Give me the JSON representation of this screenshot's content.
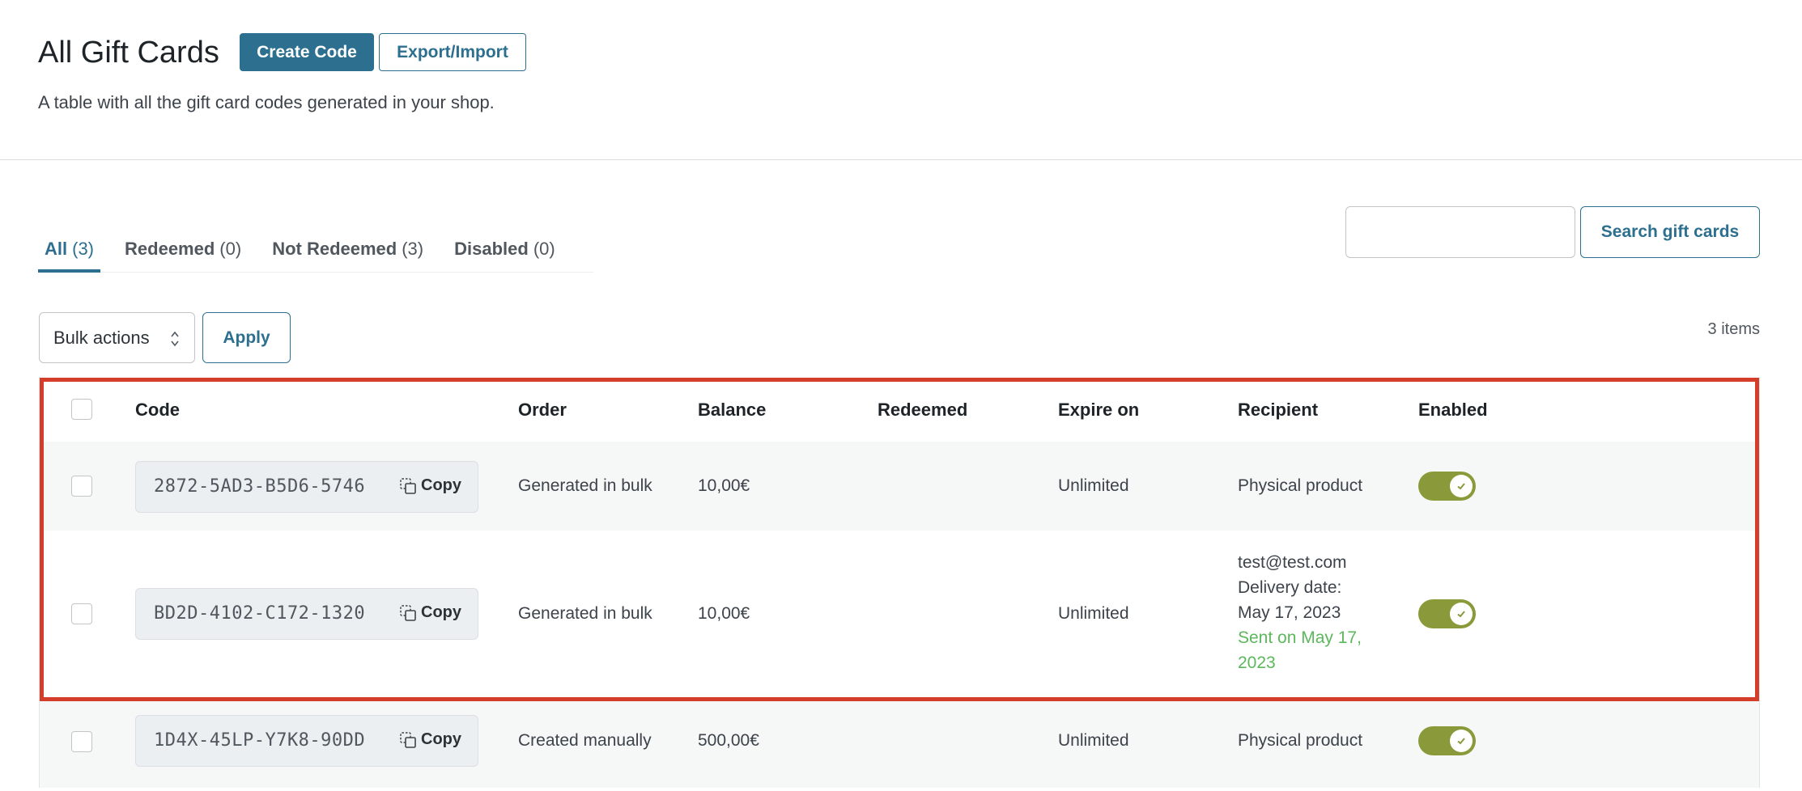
{
  "header": {
    "title": "All Gift Cards",
    "create_label": "Create Code",
    "export_label": "Export/Import",
    "description": "A table with all the gift card codes generated in your shop."
  },
  "tabs": [
    {
      "label": "All",
      "count": "(3)",
      "active": true
    },
    {
      "label": "Redeemed",
      "count": "(0)",
      "active": false
    },
    {
      "label": "Not Redeemed",
      "count": "(3)",
      "active": false
    },
    {
      "label": "Disabled",
      "count": "(0)",
      "active": false
    }
  ],
  "search": {
    "value": "",
    "button_label": "Search gift cards"
  },
  "bulk": {
    "select_value": "Bulk actions",
    "apply_label": "Apply"
  },
  "items_count": "3 items",
  "table": {
    "columns": [
      "Code",
      "Order",
      "Balance",
      "Redeemed",
      "Expire on",
      "Recipient",
      "Enabled"
    ],
    "copy_label": "Copy",
    "rows": [
      {
        "code": "2872-5AD3-B5D6-5746",
        "order": "Generated in bulk",
        "balance": "10,00€",
        "redeemed": "",
        "expire": "Unlimited",
        "recipient": "Physical product",
        "enabled": true
      },
      {
        "code": "BD2D-4102-C172-1320",
        "order": "Generated in bulk",
        "balance": "10,00€",
        "redeemed": "",
        "expire": "Unlimited",
        "recipient_email": "test@test.com",
        "delivery_label": "Delivery date:",
        "delivery_date": "May 17, 2023",
        "sent_line1": "Sent on May 17,",
        "sent_line2": "2023",
        "enabled": true
      },
      {
        "code": "1D4X-45LP-Y7K8-90DD",
        "order": "Created manually",
        "balance": "500,00€",
        "redeemed": "",
        "expire": "Unlimited",
        "recipient": "Physical product",
        "enabled": true
      }
    ]
  },
  "colors": {
    "primary": "#2c6f8f",
    "toggle_on": "#8a9a3b",
    "sent_green": "#5cb85c",
    "highlight": "#d43d2a"
  },
  "icons": [
    "copy-icon",
    "sort-arrows-icon",
    "check-icon"
  ]
}
